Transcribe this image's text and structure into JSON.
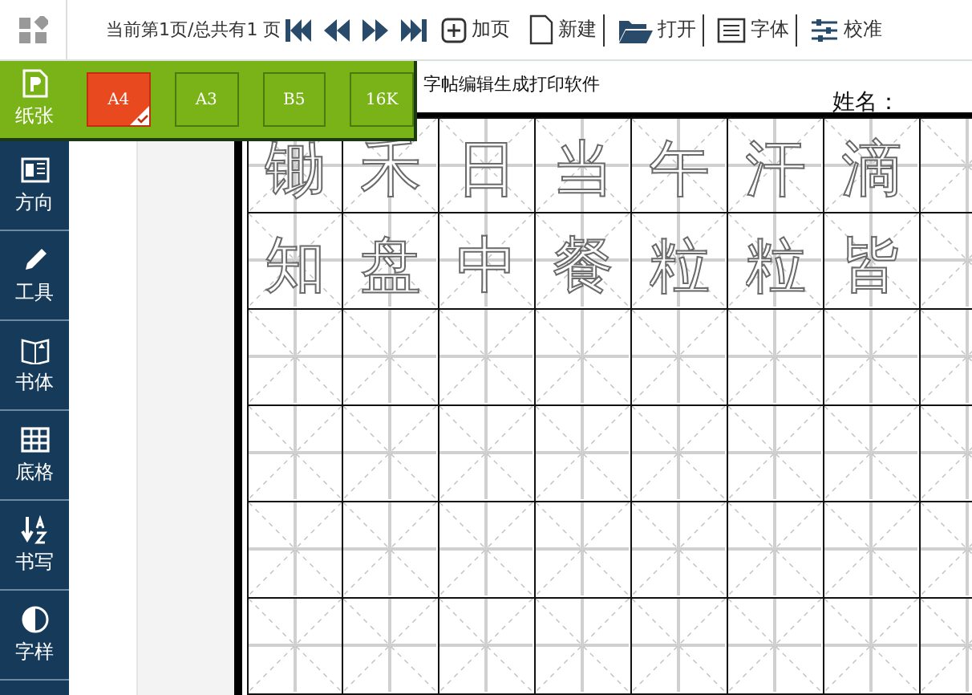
{
  "toolbar": {
    "page_info": "当前第1页/总共有1 页",
    "nav": [
      {
        "kind": "first"
      },
      {
        "kind": "prev"
      },
      {
        "kind": "next"
      },
      {
        "kind": "last"
      }
    ],
    "buttons": [
      {
        "kind": "add",
        "label": "加页"
      },
      {
        "kind": "new",
        "label": "新建"
      },
      {
        "kind": "open",
        "label": "打开"
      },
      {
        "kind": "font",
        "label": "字体"
      },
      {
        "kind": "calibrate",
        "label": "校准"
      }
    ]
  },
  "sidebar": {
    "items": [
      {
        "kind": "paper",
        "label": "纸张",
        "selected": true
      },
      {
        "kind": "orientation",
        "label": "方向",
        "selected": false
      },
      {
        "kind": "tools",
        "label": "工具",
        "selected": false
      },
      {
        "kind": "script",
        "label": "书体",
        "selected": false
      },
      {
        "kind": "grid",
        "label": "底格",
        "selected": false
      },
      {
        "kind": "writing",
        "label": "书写",
        "selected": false
      },
      {
        "kind": "style",
        "label": "字样",
        "selected": false
      }
    ]
  },
  "paper_sizes": [
    {
      "label": "A4",
      "selected": true
    },
    {
      "label": "A3",
      "selected": false
    },
    {
      "label": "B5",
      "selected": false
    },
    {
      "label": "16K",
      "selected": false
    }
  ],
  "sheet": {
    "title": "字帖编辑生成打印软件",
    "name_label": "姓名：",
    "rows": [
      {
        "cells": [
          "锄",
          "禾",
          "日",
          "当",
          "午",
          "汗",
          "滴"
        ]
      },
      {
        "cells": [
          "知",
          "盘",
          "中",
          "餐",
          "粒",
          "粒",
          "皆"
        ]
      }
    ]
  }
}
